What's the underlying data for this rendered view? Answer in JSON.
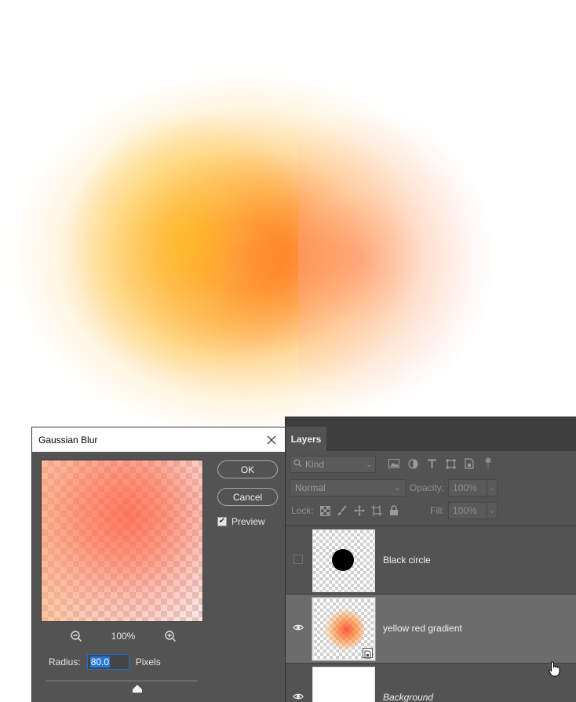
{
  "canvas": {
    "blob_colors": {
      "yellow": "#ffc936",
      "orange": "#ff7a1f",
      "red": "#ff5a2a",
      "pink": "#ffb0b0"
    }
  },
  "dialog": {
    "title": "Gaussian Blur",
    "close_icon": "close-icon",
    "ok_label": "OK",
    "cancel_label": "Cancel",
    "preview_label": "Preview",
    "preview_checked": true,
    "zoom_level": "100%",
    "radius_label": "Radius:",
    "radius_value": "80.0",
    "radius_units": "Pixels"
  },
  "layers_panel": {
    "tab_label": "Layers",
    "filter_kind": "Kind",
    "filter_icons": [
      "image-icon",
      "adjustment-icon",
      "type-icon",
      "shape-icon",
      "smart-object-icon",
      "toggle-filter-icon"
    ],
    "blend_mode": "Normal",
    "opacity_label": "Opacity:",
    "opacity_value": "100%",
    "lock_label": "Lock:",
    "lock_icons": [
      "lock-transparent-icon",
      "lock-paint-icon",
      "lock-position-icon",
      "lock-artboard-icon",
      "lock-all-icon"
    ],
    "fill_label": "Fill:",
    "fill_value": "100%",
    "layers": [
      {
        "name": "Black circle",
        "visible": false,
        "selected": false
      },
      {
        "name": "yellow red gradient",
        "visible": true,
        "selected": true
      },
      {
        "name": "Background",
        "visible": true,
        "selected": false
      }
    ]
  },
  "colors": {
    "panel_bg": "#535353",
    "selection_bg": "#6c6c6c",
    "accent_blue": "#1e6ec8"
  }
}
